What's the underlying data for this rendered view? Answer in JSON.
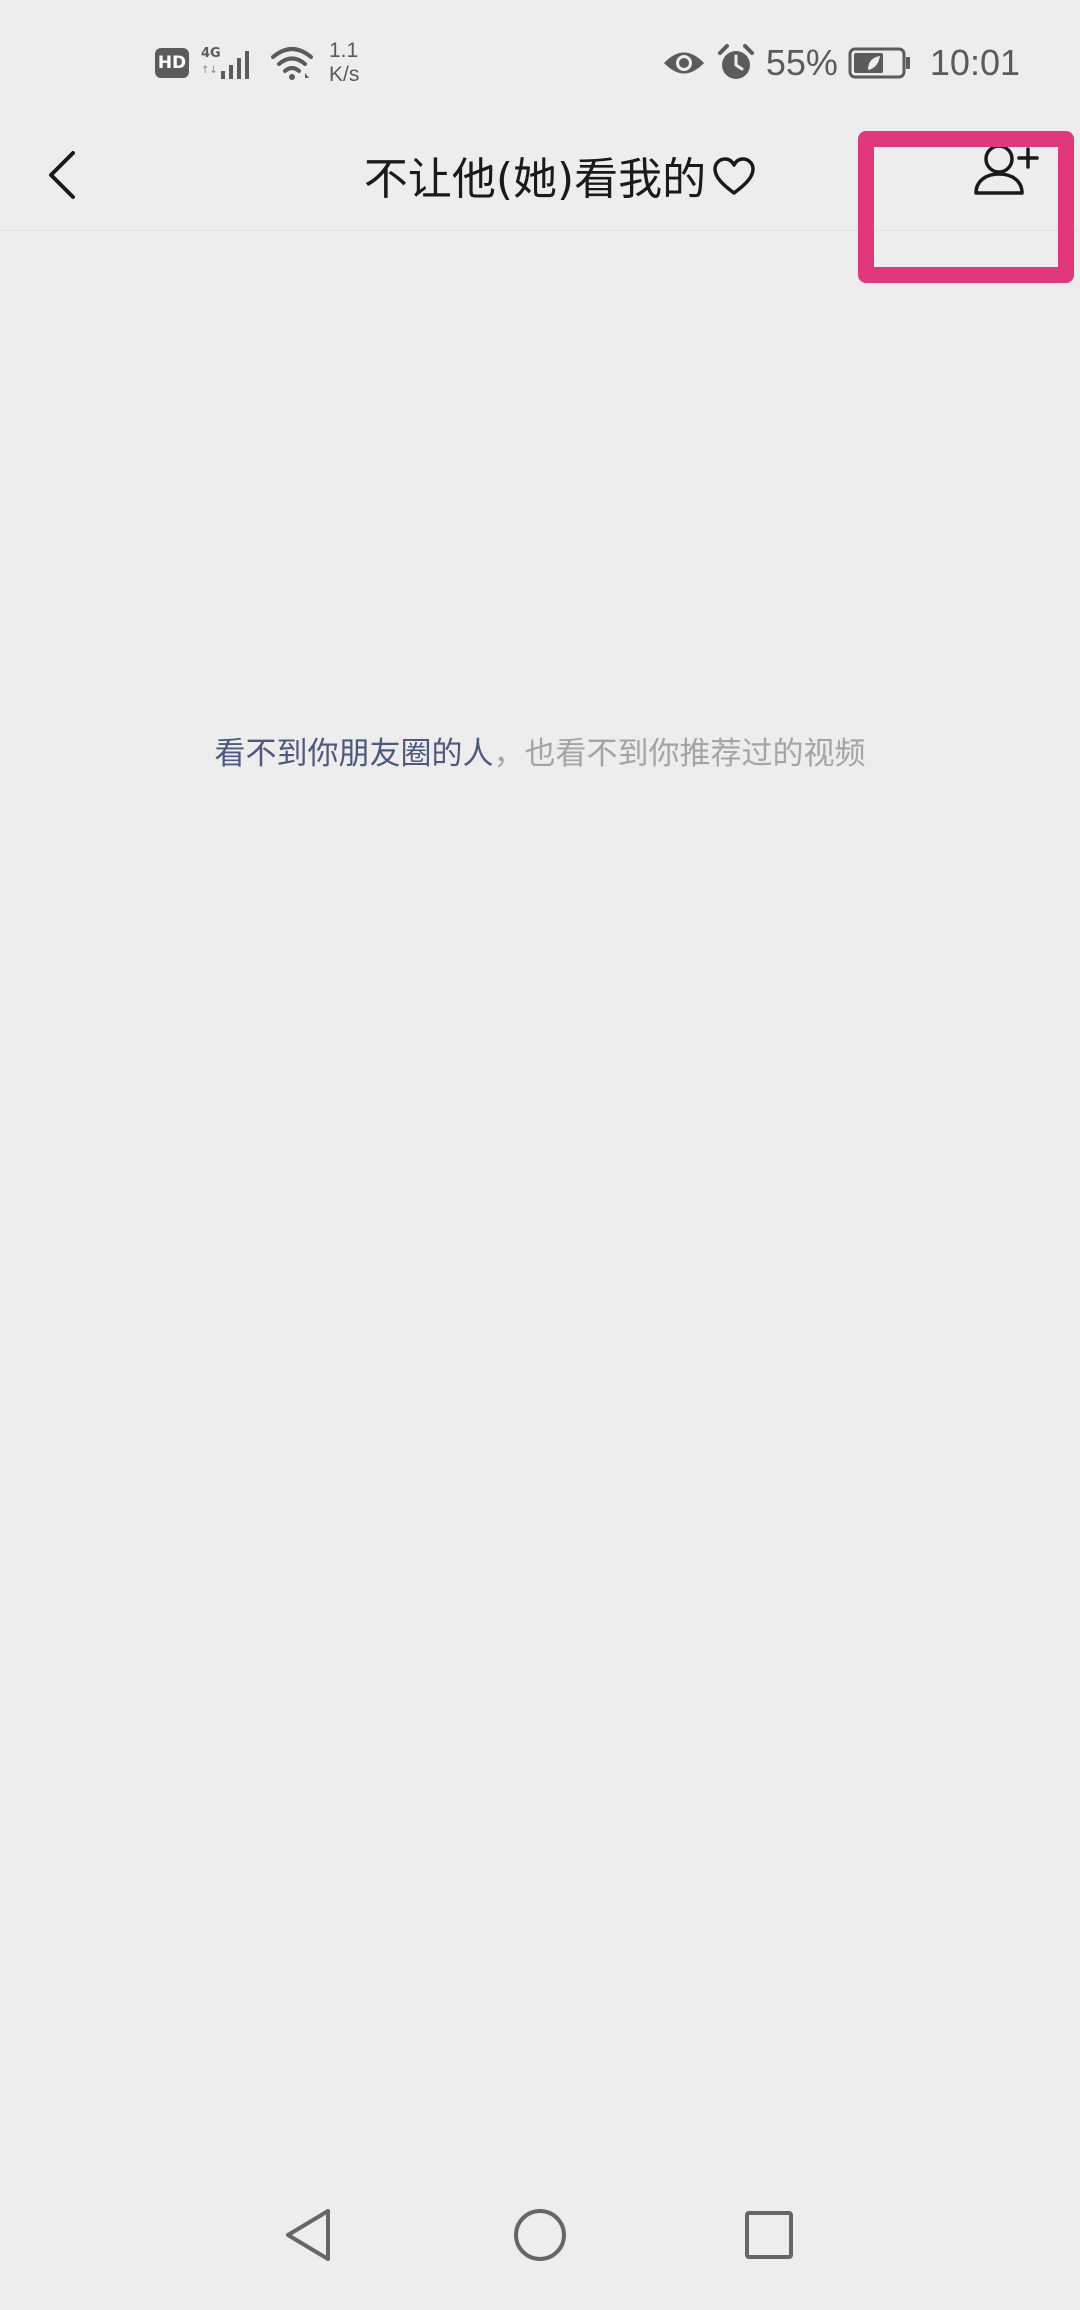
{
  "status_bar": {
    "hd_label": "HD",
    "network_type": "4G",
    "net_speed_value": "1.1",
    "net_speed_unit": "K/s",
    "battery_percent": "55%",
    "time": "10:01",
    "icons": [
      "signal-icon",
      "wifi-icon",
      "eye-icon",
      "alarm-icon",
      "battery-icon"
    ]
  },
  "header": {
    "title": "不让他(她)看我的",
    "title_icon": "heart-outline-icon",
    "back_icon": "chevron-left-icon",
    "action_icon": "add-person-icon"
  },
  "highlight": {
    "color": "#e0387a"
  },
  "empty_state": {
    "strong_text": "看不到你朋友圈的人",
    "rest_text": "，也看不到你推荐过的视频"
  },
  "nav_bar": {
    "icons": [
      "nav-back-icon",
      "nav-home-icon",
      "nav-recent-icon"
    ]
  },
  "colors": {
    "background": "#ededed",
    "title_text": "#1a1a1a",
    "hint_strong": "#4e5a7d",
    "hint_rest": "#a4a4a4"
  }
}
